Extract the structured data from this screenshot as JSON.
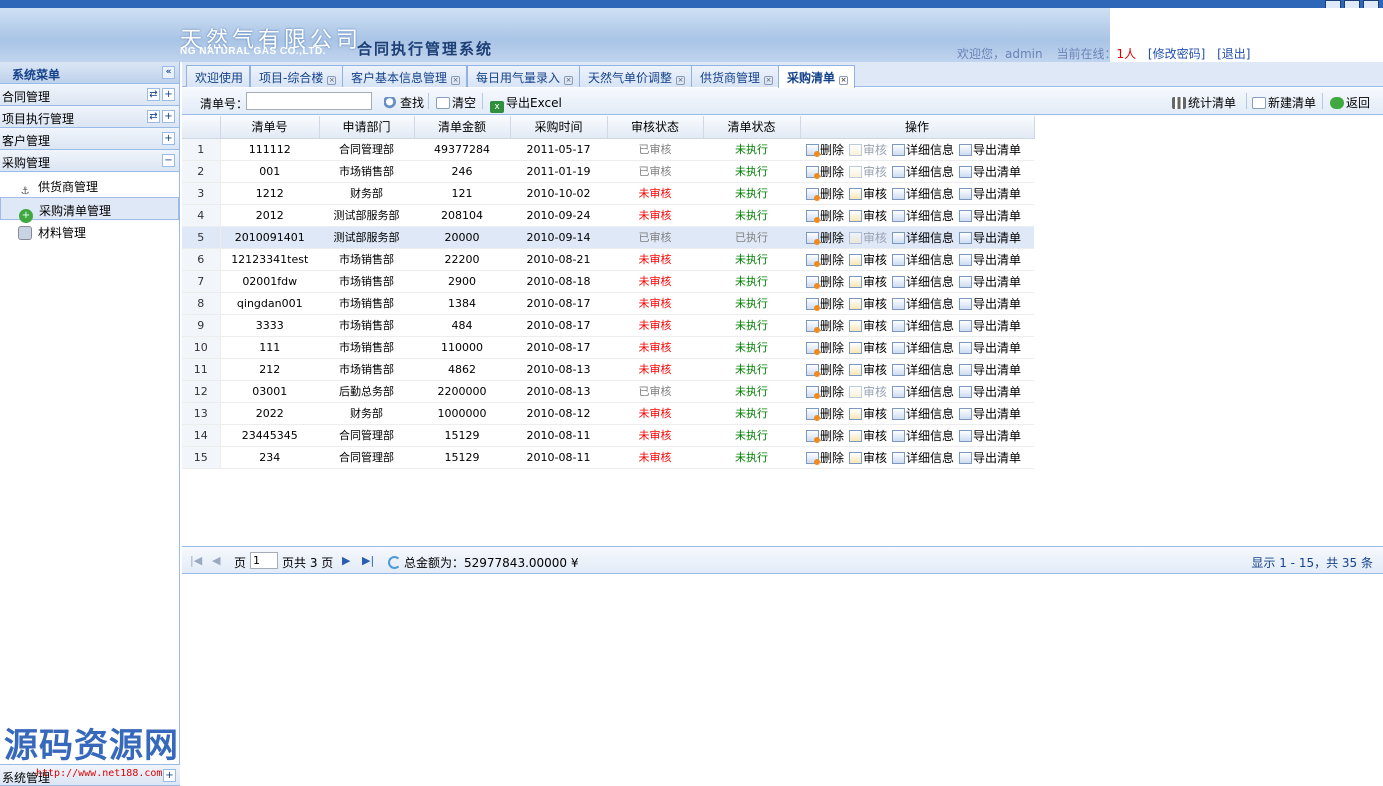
{
  "header": {
    "logo_cn": "天然气有限公司",
    "logo_en": "NG NATURAL GAS CO.,LTD.",
    "system_title": "合同执行管理系统",
    "welcome": "欢迎您，admin",
    "online_label": "当前在线：",
    "online_count": "1人",
    "change_password": "[修改密码]",
    "logout": "[退出]"
  },
  "sidebar": {
    "title": "系统菜单",
    "collapse": "«",
    "groups": [
      {
        "label": "合同管理"
      },
      {
        "label": "项目执行管理"
      },
      {
        "label": "客户管理"
      },
      {
        "label": "采购管理"
      }
    ],
    "purchase_items": [
      {
        "label": "供货商管理",
        "icon": "anchor-icon"
      },
      {
        "label": "采购清单管理",
        "icon": "add-circle-icon"
      },
      {
        "label": "材料管理",
        "icon": "database-icon"
      }
    ],
    "bottom_groups": [
      {
        "label": "系统管理"
      }
    ]
  },
  "watermark": {
    "text": "源码资源网",
    "url": "http://www.net188.com"
  },
  "tabs": [
    {
      "label": "欢迎使用",
      "closable": false
    },
    {
      "label": "项目-综合楼",
      "closable": true
    },
    {
      "label": "客户基本信息管理",
      "closable": true
    },
    {
      "label": "每日用气量录入",
      "closable": true
    },
    {
      "label": "天然气单价调整",
      "closable": true
    },
    {
      "label": "供货商管理",
      "closable": true
    },
    {
      "label": "采购清单",
      "closable": true,
      "active": true
    }
  ],
  "toolbar": {
    "search_label": "清单号：",
    "search_value": "",
    "search_btn": "查找",
    "clear_btn": "清空",
    "export_btn": "导出Excel",
    "stat_btn": "统计清单",
    "new_btn": "新建清单",
    "back_btn": "返回"
  },
  "grid": {
    "columns": [
      "清单号",
      "申请部门",
      "清单金额",
      "采购时间",
      "审核状态",
      "清单状态",
      "操作"
    ],
    "ops": {
      "delete": "删除",
      "audit": "审核",
      "detail": "详细信息",
      "export": "导出清单"
    },
    "rows": [
      {
        "no": "1",
        "code": "111112",
        "dept": "合同管理部",
        "amount": "49377284",
        "date": "2011-05-17",
        "audit": "已审核",
        "state": "未执行"
      },
      {
        "no": "2",
        "code": "001",
        "dept": "市场销售部",
        "amount": "246",
        "date": "2011-01-19",
        "audit": "已审核",
        "state": "未执行"
      },
      {
        "no": "3",
        "code": "1212",
        "dept": "财务部",
        "amount": "121",
        "date": "2010-10-02",
        "audit": "未审核",
        "state": "未执行"
      },
      {
        "no": "4",
        "code": "2012",
        "dept": "测试部服务部",
        "amount": "208104",
        "date": "2010-09-24",
        "audit": "未审核",
        "state": "未执行"
      },
      {
        "no": "5",
        "code": "2010091401",
        "dept": "测试部服务部",
        "amount": "20000",
        "date": "2010-09-14",
        "audit": "已审核",
        "state": "已执行",
        "selected": true
      },
      {
        "no": "6",
        "code": "12123341test",
        "dept": "市场销售部",
        "amount": "22200",
        "date": "2010-08-21",
        "audit": "未审核",
        "state": "未执行"
      },
      {
        "no": "7",
        "code": "02001fdw",
        "dept": "市场销售部",
        "amount": "2900",
        "date": "2010-08-18",
        "audit": "未审核",
        "state": "未执行"
      },
      {
        "no": "8",
        "code": "qingdan001",
        "dept": "市场销售部",
        "amount": "1384",
        "date": "2010-08-17",
        "audit": "未审核",
        "state": "未执行"
      },
      {
        "no": "9",
        "code": "3333",
        "dept": "市场销售部",
        "amount": "484",
        "date": "2010-08-17",
        "audit": "未审核",
        "state": "未执行"
      },
      {
        "no": "10",
        "code": "111",
        "dept": "市场销售部",
        "amount": "110000",
        "date": "2010-08-17",
        "audit": "未审核",
        "state": "未执行"
      },
      {
        "no": "11",
        "code": "212",
        "dept": "市场销售部",
        "amount": "4862",
        "date": "2010-08-13",
        "audit": "未审核",
        "state": "未执行"
      },
      {
        "no": "12",
        "code": "03001",
        "dept": "后勤总务部",
        "amount": "2200000",
        "date": "2010-08-13",
        "audit": "已审核",
        "state": "未执行"
      },
      {
        "no": "13",
        "code": "2022",
        "dept": "财务部",
        "amount": "1000000",
        "date": "2010-08-12",
        "audit": "未审核",
        "state": "未执行"
      },
      {
        "no": "14",
        "code": "23445345",
        "dept": "合同管理部",
        "amount": "15129",
        "date": "2010-08-11",
        "audit": "未审核",
        "state": "未执行"
      },
      {
        "no": "15",
        "code": "234",
        "dept": "合同管理部",
        "amount": "15129",
        "date": "2010-08-11",
        "audit": "未审核",
        "state": "未执行"
      }
    ]
  },
  "pager": {
    "page_label": "页",
    "page_value": "1",
    "total_pages": "页共 3 页",
    "total_amount": "总金额为：52977843.00000 ¥",
    "display_info": "显示 1 - 15，共 35 条"
  }
}
